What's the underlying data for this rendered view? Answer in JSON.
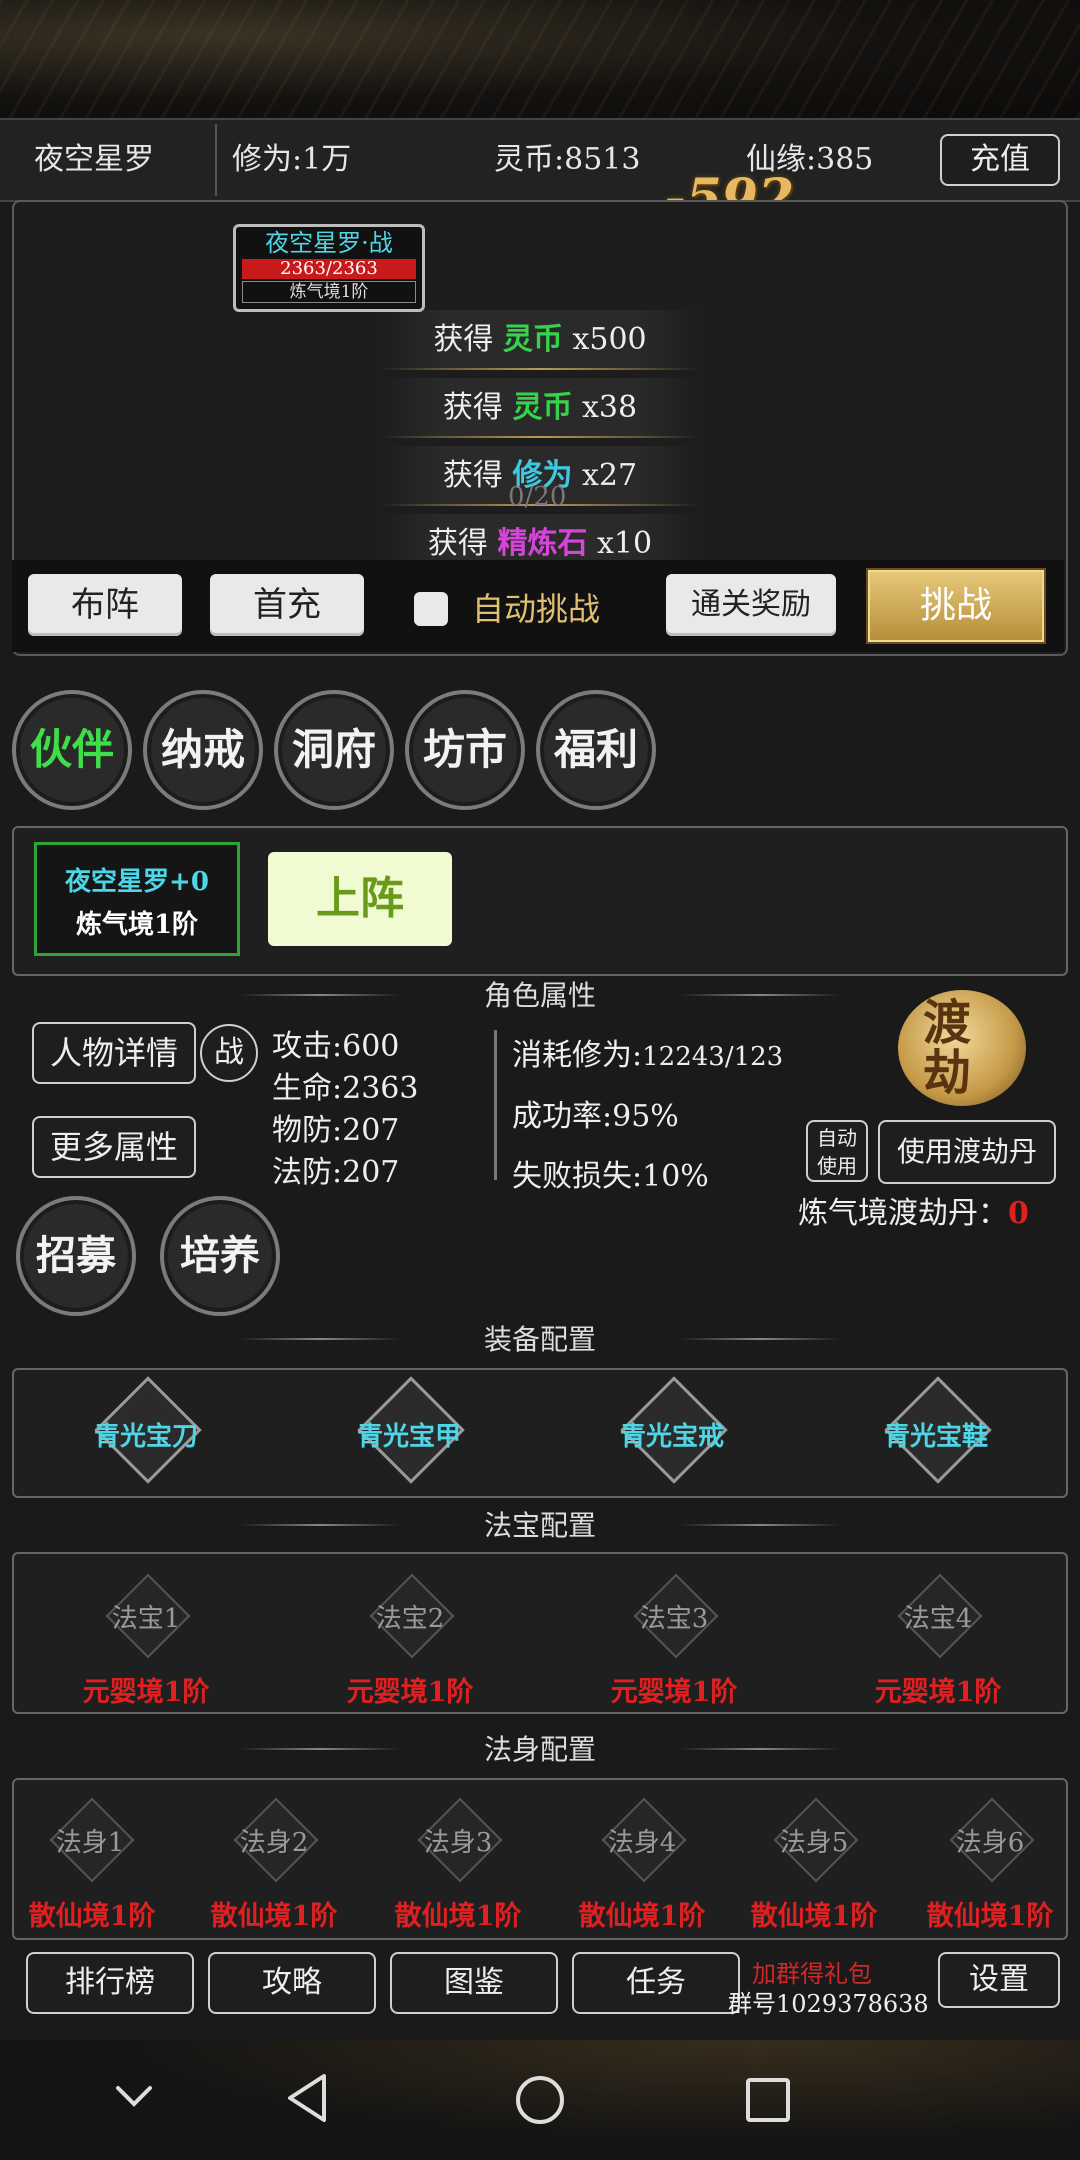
{
  "status": {
    "name": "夜空星罗",
    "cultivation": "修为:1万",
    "spirit_coins": "灵币:8513",
    "fate": "仙缘:385",
    "recharge_btn": "充值",
    "damage_popup": "-592"
  },
  "battle": {
    "enemy_name": "夜空星罗·战",
    "enemy_hp": "2363/2363",
    "enemy_realm": "炼气境1阶",
    "wave_progress": "0/20",
    "rewards": [
      {
        "prefix": "获得",
        "item": "灵币",
        "qty": "x500",
        "color": "#34d34a"
      },
      {
        "prefix": "获得",
        "item": "灵币",
        "qty": "x38",
        "color": "#34d34a"
      },
      {
        "prefix": "获得",
        "item": "修为",
        "qty": "x27",
        "color": "#3fc8e0"
      },
      {
        "prefix": "获得",
        "item": "精炼石",
        "qty": "x10",
        "color": "#d445d8"
      }
    ],
    "buttons": {
      "formation": "布阵",
      "first_charge": "首充",
      "auto_challenge": "自动挑战",
      "clear_reward": "通关奖励",
      "challenge": "挑战"
    }
  },
  "tabs": [
    "伙伴",
    "纳戒",
    "洞府",
    "坊市",
    "福利"
  ],
  "companion": {
    "card_name": "夜空星罗+0",
    "card_realm": "炼气境1阶",
    "deploy_btn": "上阵"
  },
  "attributes": {
    "section_title": "角色属性",
    "detail_btn": "人物详情",
    "battle_badge": "战",
    "more_btn": "更多属性",
    "attack": "攻击:600",
    "hp": "生命:2363",
    "pdef": "物防:207",
    "mdef": "法防:207",
    "cost_label": "消耗修为:",
    "cost_value": "12243/123",
    "success": "成功率:95%",
    "fail_loss": "失败损失:10%",
    "tribulation_emblem": "渡劫",
    "auto_use_1": "自动",
    "auto_use_2": "使用",
    "use_pill_btn": "使用渡劫丹",
    "pill_label": "炼气境渡劫丹：",
    "pill_count": "0",
    "recruit_btn": "招募",
    "train_btn": "培养"
  },
  "equipment": {
    "section_title": "装备配置",
    "items": [
      "青光宝刀",
      "青光宝甲",
      "青光宝戒",
      "青光宝鞋"
    ]
  },
  "treasures": {
    "section_title": "法宝配置",
    "slots": [
      "法宝1",
      "法宝2",
      "法宝3",
      "法宝4"
    ],
    "requirement": "元婴境1阶"
  },
  "avatars": {
    "section_title": "法身配置",
    "slots": [
      "法身1",
      "法身2",
      "法身3",
      "法身4",
      "法身5",
      "法身6"
    ],
    "requirement": "散仙境1阶"
  },
  "bottom": {
    "ranking": "排行榜",
    "guide": "攻略",
    "codex": "图鉴",
    "tasks": "任务",
    "group_promo": "加群得礼包",
    "group_number": "群号1029378638",
    "settings": "设置"
  }
}
